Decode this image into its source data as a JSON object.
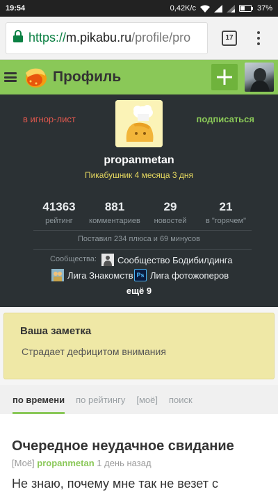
{
  "status_bar": {
    "time": "19:54",
    "network_speed": "0,42K/c",
    "battery": "37%"
  },
  "browser": {
    "url_scheme": "https://",
    "url_host": "m.pikabu.ru",
    "url_path": "/profile/pro",
    "tab_count": "17"
  },
  "header": {
    "title": "Профиль"
  },
  "profile": {
    "ignore_label": "в игнор-лист",
    "subscribe_label": "подписаться",
    "username": "propanmetan",
    "since": "Пикабушник 4 месяца 3 дня",
    "stats": [
      {
        "value": "41363",
        "label": "рейтинг"
      },
      {
        "value": "881",
        "label": "комментариев"
      },
      {
        "value": "29",
        "label": "новостей"
      },
      {
        "value": "21",
        "label": "в \"горячем\""
      }
    ],
    "votes": "Поставил 234 плюса и 69 минусов",
    "communities_label": "Сообщества:",
    "communities": [
      {
        "name": "Сообщество Бодибилдинга",
        "icon": "bodybuilding-community-icon"
      },
      {
        "name": "Лига Знакомств",
        "icon": "dating-league-icon"
      },
      {
        "name": "Лига фотожоперов",
        "icon": "photoshop-league-icon",
        "icon_text": "Ps"
      }
    ],
    "more": "ещё 9"
  },
  "note": {
    "title": "Ваша заметка",
    "text": "Страдает дефицитом внимания"
  },
  "sort_tabs": [
    {
      "label": "по времени",
      "active": true
    },
    {
      "label": "по рейтингу",
      "active": false
    },
    {
      "label": "[моё]",
      "active": false
    },
    {
      "label": "поиск",
      "active": false
    }
  ],
  "post": {
    "title": "Очередное неудачное свидание",
    "tag": "[Моё]",
    "author": "propanmetan",
    "time": "1 день назад",
    "text": "Не знаю, почему мне так не везет с"
  },
  "colors": {
    "accent": "#8ac858",
    "profile_bg": "#2b3134",
    "danger": "#e0584e",
    "note_bg": "#efe8a6"
  }
}
